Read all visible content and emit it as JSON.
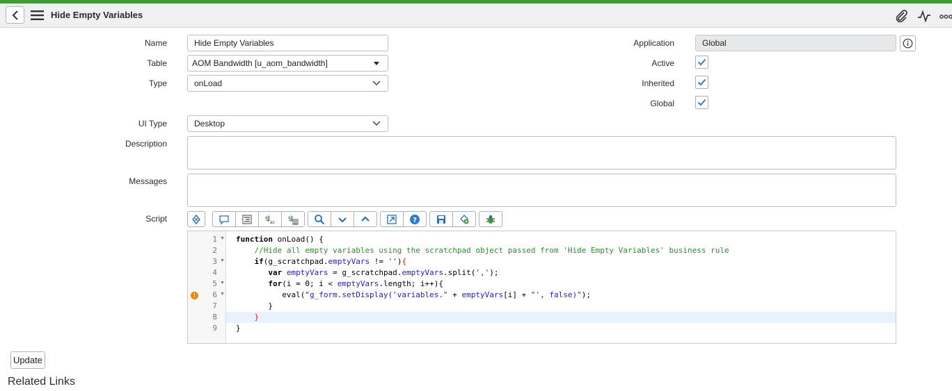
{
  "header": {
    "title": "Hide Empty Variables",
    "icons": [
      "back-icon",
      "hamburger-menu-icon",
      "paperclip-icon",
      "activity-pulse-icon",
      "more-options-icon"
    ]
  },
  "form": {
    "name": {
      "label": "Name",
      "value": "Hide Empty Variables"
    },
    "table": {
      "label": "Table",
      "value": "AOM Bandwidth [u_aom_bandwidth]"
    },
    "type": {
      "label": "Type",
      "value": "onLoad"
    },
    "ui_type": {
      "label": "UI Type",
      "value": "Desktop"
    },
    "description": {
      "label": "Description",
      "value": ""
    },
    "messages": {
      "label": "Messages",
      "value": ""
    },
    "script": {
      "label": "Script"
    },
    "application": {
      "label": "Application",
      "value": "Global"
    },
    "active": {
      "label": "Active",
      "checked": true
    },
    "inherited": {
      "label": "Inherited",
      "checked": true
    },
    "global": {
      "label": "Global",
      "checked": true
    }
  },
  "toolbar": {
    "buttons": [
      "toggle-syntax-icon",
      "comment-icon",
      "format-code-icon",
      "replace-icon",
      "replace-all-icon",
      "search-icon",
      "fold-down-icon",
      "fold-up-icon",
      "fullscreen-icon",
      "help-icon",
      "save-icon",
      "script-include-icon",
      "debug-icon"
    ]
  },
  "editor": {
    "line_numbers": [
      "1",
      "2",
      "3",
      "4",
      "5",
      "6",
      "7",
      "8",
      "9"
    ],
    "lines": [
      "function onLoad() {",
      "    //Hide all empty variables using the scratchpad object passed from 'Hide Empty Variables' business rule",
      "    if(g_scratchpad.emptyVars != ''){",
      "       var emptyVars = g_scratchpad.emptyVars.split(',');",
      "       for(i = 0; i < emptyVars.length; i++){",
      "          eval(\"g_form.setDisplay('variables.\" + emptyVars[i] + \"', false)\");",
      "       }",
      "    }",
      "}"
    ],
    "highlighted_line": 8,
    "warning_line": 6
  },
  "actions": {
    "update_label": "Update"
  },
  "related_links": {
    "title": "Related Links"
  },
  "colors": {
    "accent": "#3f9c35",
    "check": "#2e7fc4",
    "comment": "#2e8a2e",
    "string": "#1e1ec8",
    "warning": "#e8860b"
  }
}
